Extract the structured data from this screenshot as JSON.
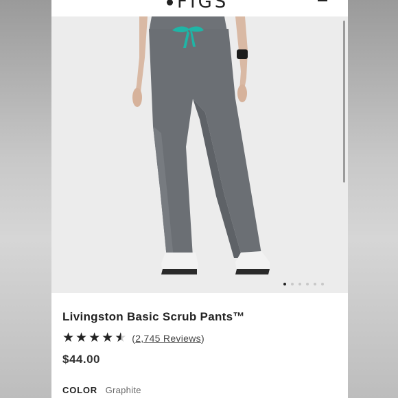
{
  "header": {
    "logo_text": "FIGS",
    "logo_icon": "figs-dot-logo",
    "menu_icon": "hamburger-menu-icon"
  },
  "gallery": {
    "image_alt": "Woman wearing graphite scrub pants with teal drawstring and white sneakers",
    "image_count": 6,
    "active_index": 0
  },
  "product": {
    "title": "Livingston Basic Scrub Pants™",
    "rating": 4.5,
    "reviews_text": "2,745 Reviews",
    "reviews_open": "(",
    "reviews_close": ")",
    "price": "$44.00",
    "color_label": "COLOR",
    "color_value": "Graphite"
  },
  "colors": {
    "pants": "#6b6f74",
    "drawstring": "#1fb5a6",
    "background": "#ececec"
  }
}
